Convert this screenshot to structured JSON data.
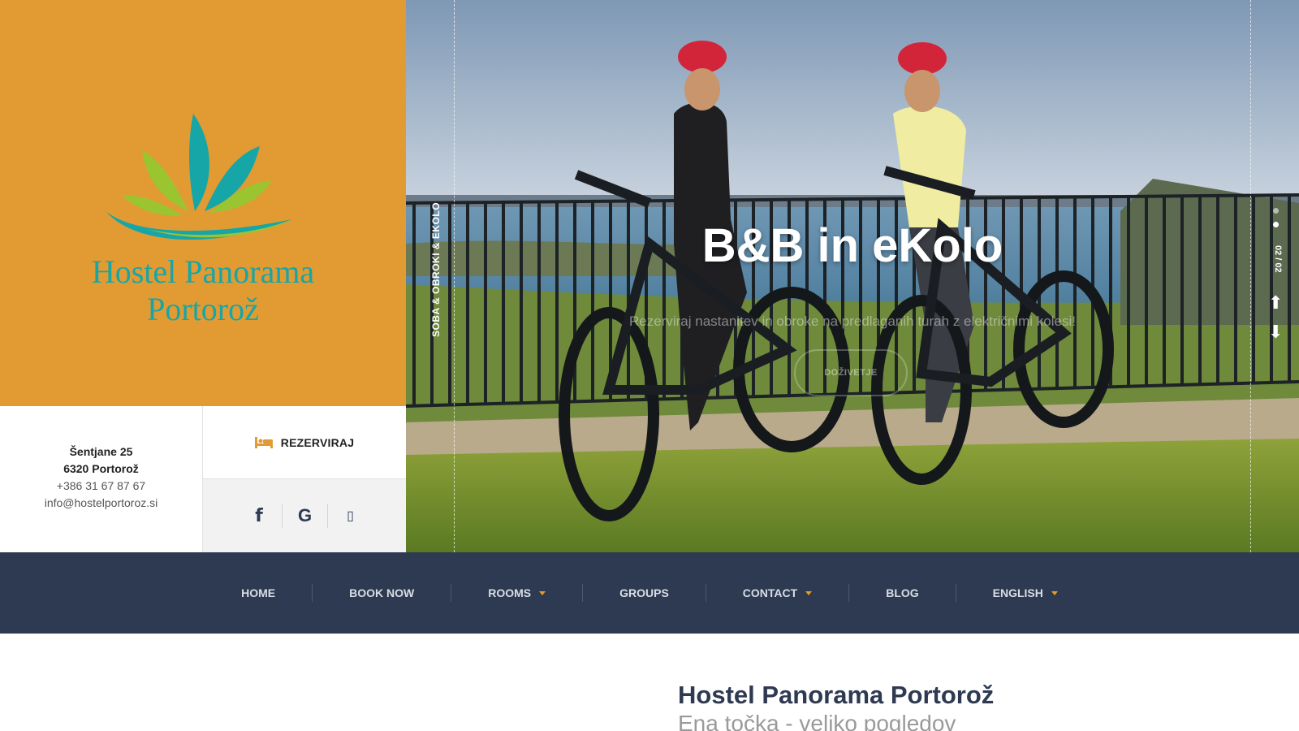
{
  "brand": {
    "name_line1": "Hostel Panorama",
    "name_line2": "Portorož",
    "colors": {
      "orange": "#e19b32",
      "teal": "#17a6a8",
      "green": "#9bc431",
      "navy": "#2e3a52"
    }
  },
  "contact": {
    "street": "Šentjane 25",
    "city": "6320 Portorož",
    "phone": "+386 31 67 87 67",
    "email": "info@hostelportoroz.si"
  },
  "reserve": {
    "icon": "bed-icon",
    "label": "REZERVIRAJ"
  },
  "social": [
    {
      "name": "facebook-icon",
      "glyph": "f"
    },
    {
      "name": "google-icon",
      "glyph": "G"
    },
    {
      "name": "tripadvisor-icon",
      "glyph": "▯"
    }
  ],
  "hero": {
    "side_label": "SOBA & OBROKI & EKOLO",
    "title": "B&B in eKolo",
    "subtitle": "Rezerviraj nastanitev in obroke na predlaganih turah z električnimi kolesi!",
    "button": "DOŽIVETJE",
    "counter": "02 / 02",
    "arrows": {
      "up": "⬆",
      "down": "⬇"
    }
  },
  "nav": {
    "items": [
      {
        "label": "HOME",
        "dropdown": false
      },
      {
        "label": "BOOK NOW",
        "dropdown": false
      },
      {
        "label": "ROOMS",
        "dropdown": true
      },
      {
        "label": "GROUPS",
        "dropdown": false
      },
      {
        "label": "CONTACT",
        "dropdown": true
      },
      {
        "label": "BLOG",
        "dropdown": false
      },
      {
        "label": "ENGLISH",
        "dropdown": true
      }
    ]
  },
  "intro": {
    "title": "Hostel Panorama Portorož",
    "subtitle": "Ena točka - veliko pogledov"
  }
}
